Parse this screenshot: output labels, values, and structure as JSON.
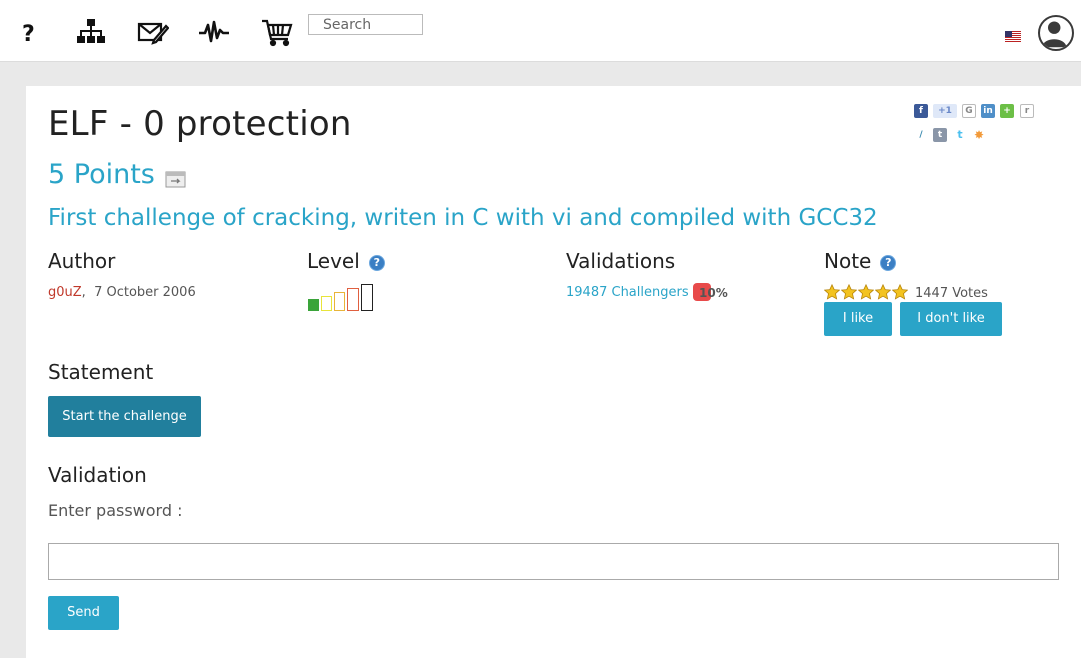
{
  "nav": {
    "icons": [
      "help-icon",
      "sitemap-icon",
      "mail-icon",
      "activity-icon",
      "cart-icon"
    ],
    "search": {
      "placeholder": "Search",
      "value": ""
    },
    "flag": "us-flag-icon",
    "avatar": "user-avatar-icon"
  },
  "challenge": {
    "title": "ELF - 0 protection",
    "points": "5 Points",
    "subtitle": "First challenge of cracking, writen in C with vi and compiled with GCC32"
  },
  "share_icons": [
    "facebook",
    "google-plus",
    "google",
    "linkedin",
    "add",
    "reddit",
    "delicious",
    "tumblr",
    "twitter",
    "stumbleupon"
  ],
  "author": {
    "heading": "Author",
    "name": "g0uZ",
    "separator": ",",
    "date": "7 October 2006"
  },
  "level": {
    "heading": "Level",
    "current": 1,
    "max": 5,
    "colors": [
      "#3aa43a",
      "#e8e43a",
      "#e8b43a",
      "#e06040",
      "#222222"
    ]
  },
  "validations": {
    "heading": "Validations",
    "challengers": "19487 Challengers",
    "percent": "10%",
    "badge_color": "#e84a4a"
  },
  "note": {
    "heading": "Note",
    "stars": 5,
    "votes": "1447 Votes",
    "like_label": "I like",
    "dislike_label": "I don't like"
  },
  "statement": {
    "heading": "Statement",
    "start_label": "Start the challenge"
  },
  "validation_form": {
    "heading": "Validation",
    "label": "Enter password :",
    "value": "",
    "send_label": "Send"
  },
  "colors": {
    "accent": "#2aa4c8",
    "accent_dark": "#217f9d",
    "author": "#c0392b"
  }
}
